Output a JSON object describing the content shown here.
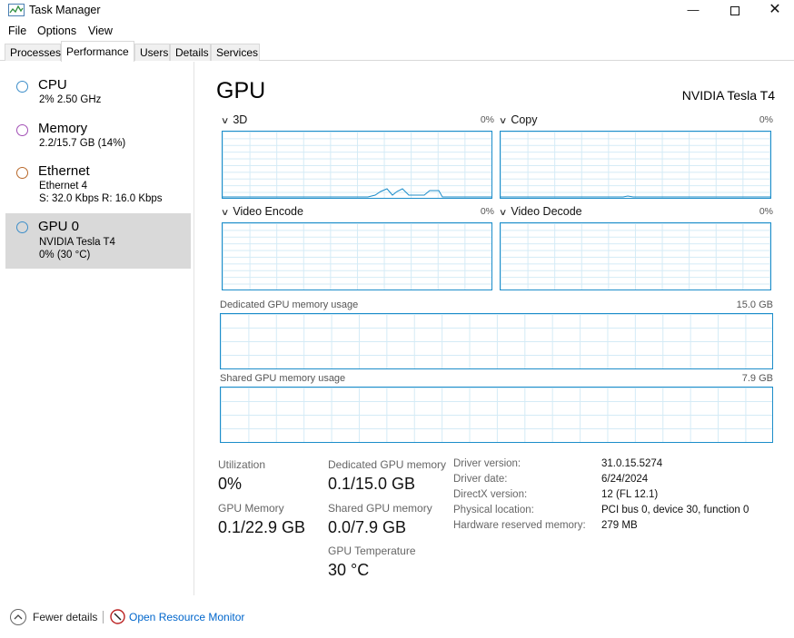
{
  "window": {
    "title": "Task Manager",
    "minimize_icon": "minimize-icon",
    "maximize_icon": "maximize-icon",
    "close_icon": "close-icon"
  },
  "menu": [
    "File",
    "Options",
    "View"
  ],
  "tabs": [
    "Processes",
    "Performance",
    "Users",
    "Details",
    "Services"
  ],
  "active_tab": "Performance",
  "sidebar": {
    "items": [
      {
        "name": "CPU",
        "line1": "2% 2.50 GHz",
        "line2": "",
        "color": "#3d8ec9"
      },
      {
        "name": "Memory",
        "line1": "2.2/15.7 GB (14%)",
        "line2": "",
        "color": "#a24fb5"
      },
      {
        "name": "Ethernet",
        "line1": "Ethernet 4",
        "line2": "S: 32.0 Kbps R: 16.0 Kbps",
        "color": "#b8682a"
      },
      {
        "name": "GPU 0",
        "line1": "NVIDIA Tesla T4",
        "line2": "0% (30 °C)",
        "color": "#3d8ec9",
        "selected": true
      }
    ]
  },
  "main": {
    "title": "GPU",
    "model": "NVIDIA Tesla T4",
    "engines": [
      {
        "label": "3D",
        "percent": "0%"
      },
      {
        "label": "Copy",
        "percent": "0%"
      },
      {
        "label": "Video Encode",
        "percent": "0%"
      },
      {
        "label": "Video Decode",
        "percent": "0%"
      }
    ],
    "dedicated_memory_graph": {
      "label": "Dedicated GPU memory usage",
      "max": "15.0 GB"
    },
    "shared_memory_graph": {
      "label": "Shared GPU memory usage",
      "max": "7.9 GB"
    },
    "stats": {
      "utilization_label": "Utilization",
      "utilization_value": "0%",
      "dedicated_label": "Dedicated GPU memory",
      "dedicated_value": "0.1/15.0 GB",
      "gpu_memory_label": "GPU Memory",
      "gpu_memory_value": "0.1/22.9 GB",
      "shared_label": "Shared GPU memory",
      "shared_value": "0.0/7.9 GB",
      "temp_label": "GPU Temperature",
      "temp_value": "30 °C"
    },
    "driver": [
      {
        "label": "Driver version:",
        "value": "31.0.15.5274"
      },
      {
        "label": "Driver date:",
        "value": "6/24/2024"
      },
      {
        "label": "DirectX version:",
        "value": "12 (FL 12.1)"
      },
      {
        "label": "Physical location:",
        "value": "PCI bus 0, device 30, function 0"
      },
      {
        "label": "Hardware reserved memory:",
        "value": "279 MB"
      }
    ]
  },
  "footer": {
    "fewer_details": "Fewer details",
    "open_monitor": "Open Resource Monitor"
  },
  "accent_color": "#1c8dca"
}
